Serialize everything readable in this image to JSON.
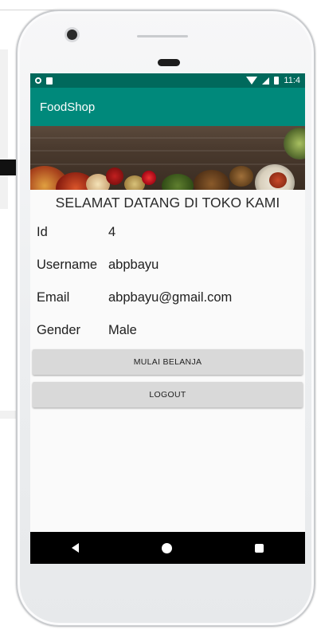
{
  "status_bar": {
    "time": "11:4"
  },
  "app_bar": {
    "title": "FoodShop"
  },
  "welcome": {
    "text": "SELAMAT DATANG DI TOKO KAMI"
  },
  "profile": {
    "rows": [
      {
        "label": "Id",
        "value": "4"
      },
      {
        "label": "Username",
        "value": "abpbayu"
      },
      {
        "label": "Email",
        "value": "abpbayu@gmail.com"
      },
      {
        "label": "Gender",
        "value": "Male"
      }
    ]
  },
  "buttons": {
    "start_shopping": "MULAI BELANJA",
    "logout": "LOGOUT"
  },
  "icons": {
    "nav": [
      "back-icon",
      "home-icon",
      "recent-apps-icon"
    ],
    "status": [
      "notification-dot-icon",
      "sd-card-icon",
      "wifi-icon",
      "signal-icon",
      "battery-icon"
    ]
  },
  "colors": {
    "status_bar": "#00695c",
    "app_bar": "#00897b",
    "button": "#d9d9d9"
  }
}
